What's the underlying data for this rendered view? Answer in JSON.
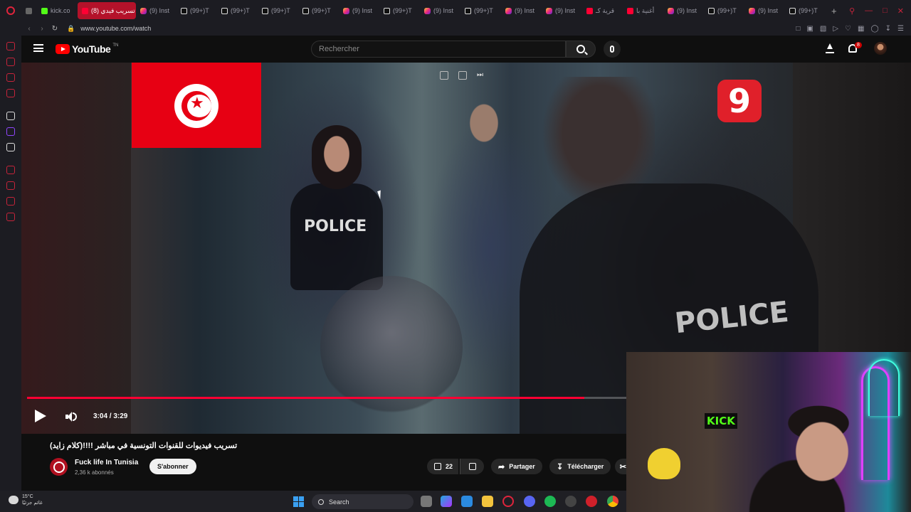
{
  "browser": {
    "tabs": [
      {
        "label": "",
        "icon": "tab-manager-icon"
      },
      {
        "label": "kick.co",
        "icon": "kick-icon"
      },
      {
        "label": "تسريب فيدي (8)",
        "icon": "youtube-icon",
        "active": true
      },
      {
        "label": "(9) Inst",
        "icon": "instagram-icon"
      },
      {
        "label": "(99+)T",
        "icon": "tiktok-icon"
      },
      {
        "label": "(99+)T",
        "icon": "tiktok-icon"
      },
      {
        "label": "(99+)T",
        "icon": "tiktok-icon"
      },
      {
        "label": "(99+)T",
        "icon": "tiktok-icon"
      },
      {
        "label": "(9) Inst",
        "icon": "instagram-icon"
      },
      {
        "label": "(99+)T",
        "icon": "tiktok-icon"
      },
      {
        "label": "(9) Inst",
        "icon": "instagram-icon"
      },
      {
        "label": "(99+)T",
        "icon": "tiktok-icon"
      },
      {
        "label": "(9) Inst",
        "icon": "instagram-icon"
      },
      {
        "label": "(9) Inst",
        "icon": "instagram-icon"
      },
      {
        "label": "قرية كـ",
        "icon": "youtube-icon"
      },
      {
        "label": "أغنية با",
        "icon": "youtube-icon"
      },
      {
        "label": "(9) Inst",
        "icon": "instagram-icon"
      },
      {
        "label": "(99+)T",
        "icon": "tiktok-icon"
      },
      {
        "label": "(9) Inst",
        "icon": "instagram-icon"
      },
      {
        "label": "(99+)T",
        "icon": "tiktok-icon"
      }
    ],
    "url": "www.youtube.com/watch",
    "accent": "#c6243a"
  },
  "youtube": {
    "logo_text": "YouTube",
    "logo_region": "TN",
    "search_placeholder": "Rechercher",
    "notification_count": "8"
  },
  "player": {
    "time_display": "3:04 / 3:29",
    "progress": 0.93,
    "channel_overlay_digit": "9",
    "scene_text_1": "POLICE",
    "scene_text_2": "POLICE"
  },
  "video": {
    "title": "تسريب فيديوات للقنوات التونسية في مباشر !!!!(كلام زايد)",
    "channel_name": "Fuck life In Tunisia",
    "subscribers": "2,36 k abonnés",
    "subscribe_label": "S'abonner",
    "likes": "22",
    "share_label": "Partager",
    "download_label": "Télécharger"
  },
  "webcam": {
    "sign_text": "KICK"
  },
  "taskbar": {
    "temperature": "15°C",
    "weather_text": "غائم جزئيًا",
    "search_label": "Search"
  }
}
